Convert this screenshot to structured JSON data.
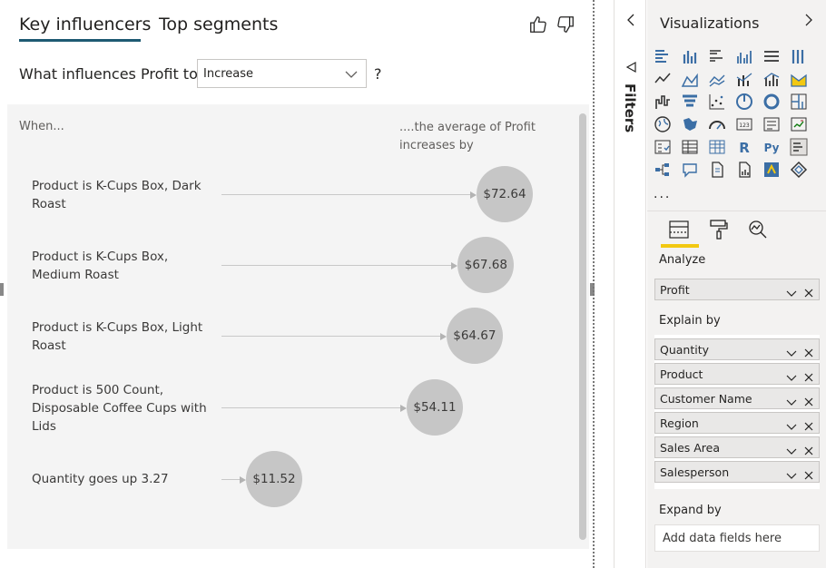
{
  "visual": {
    "tabs": [
      {
        "label": "Key influencers",
        "active": true
      },
      {
        "label": "Top segments",
        "active": false
      }
    ],
    "question_prefix": "What influences Profit to",
    "question_suffix": "?",
    "dropdown_value": "Increase",
    "col_when": "When...",
    "col_avg": "....the average of Profit increases by",
    "icons": {
      "like": "thumbs-up-icon",
      "dislike": "thumbs-down-icon"
    },
    "rows": [
      {
        "label": "Product is K-Cups Box, Dark Roast",
        "value": "$72.64",
        "amount": 72.64
      },
      {
        "label": "Product is K-Cups Box, Medium Roast",
        "value": "$67.68",
        "amount": 67.68
      },
      {
        "label": "Product is K-Cups Box, Light Roast",
        "value": "$64.67",
        "amount": 64.67
      },
      {
        "label": "Product is 500 Count, Disposable Coffee Cups with Lids",
        "value": "$54.11",
        "amount": 54.11
      },
      {
        "label": "Quantity goes up 3.27",
        "value": "$11.52",
        "amount": 11.52
      }
    ]
  },
  "filters": {
    "label": "Filters"
  },
  "viz_pane": {
    "title": "Visualizations",
    "more": "...",
    "analyze_label": "Analyze",
    "analyze_field": "Profit",
    "explain_label": "Explain by",
    "explain_fields": [
      "Quantity",
      "Product",
      "Customer Name",
      "Region",
      "Sales Area",
      "Salesperson"
    ],
    "expand_label": "Expand by",
    "expand_placeholder": "Add data fields here",
    "mode_tabs": [
      "fields-icon",
      "format-paint-icon",
      "analytics-icon"
    ],
    "accent": "#f2c811"
  },
  "colors": {
    "tab_underline": "#1e5a72",
    "bubble": "#c6c6c6",
    "panel_bg": "#f4f4f4"
  }
}
